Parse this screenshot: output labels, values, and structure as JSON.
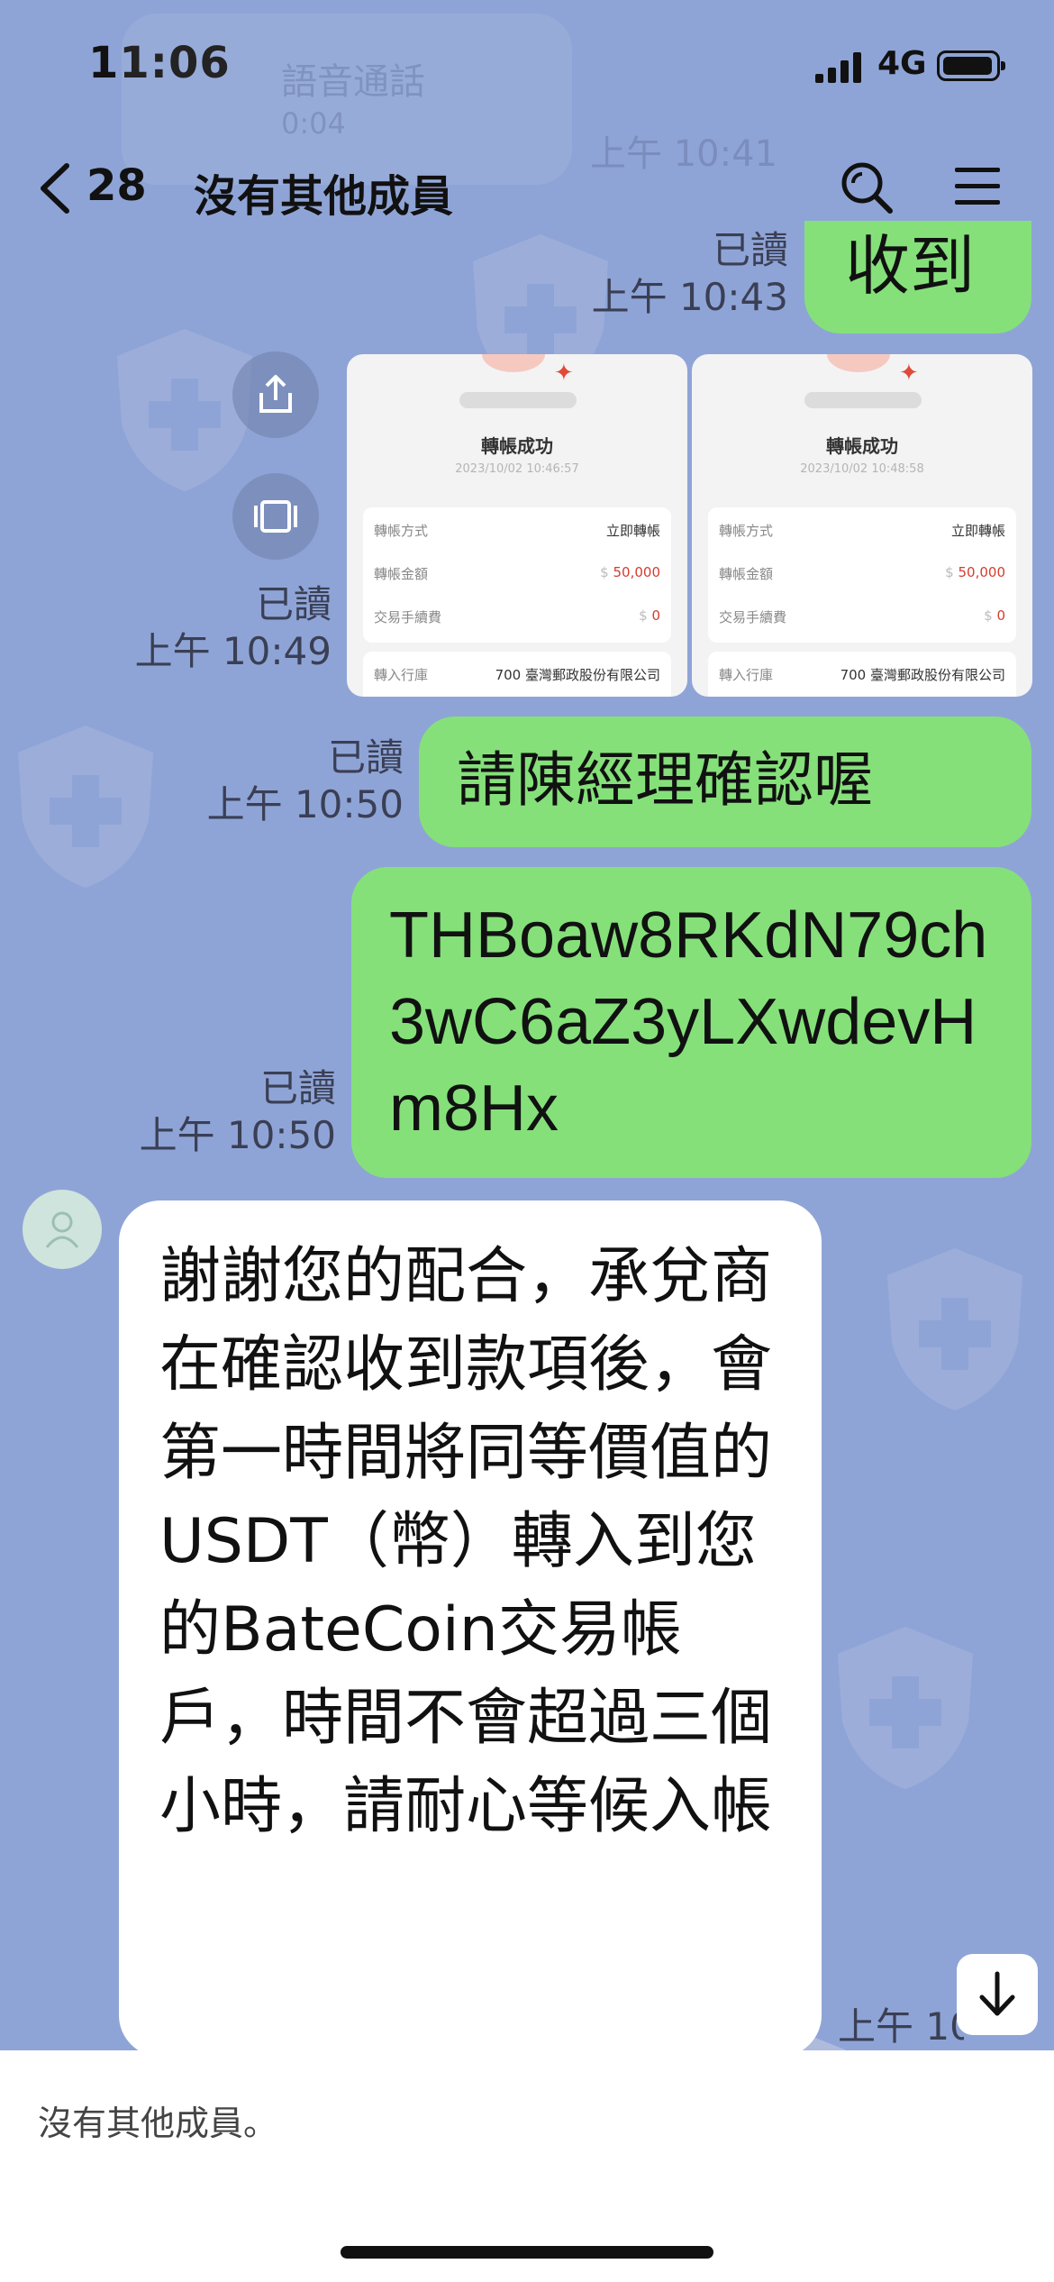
{
  "status_bar": {
    "time": "11:06",
    "network": "4G"
  },
  "ghost": {
    "call_label": "語音通話",
    "call_duration": "0:04",
    "call_time": "上午 10:41"
  },
  "header": {
    "back_count": "28",
    "title": "沒有其他成員"
  },
  "messages": [
    {
      "id": "msg1",
      "text": "收到",
      "read": "已讀",
      "time": "上午 10:43"
    },
    {
      "id": "msg2",
      "type": "images",
      "read": "已讀",
      "time": "上午 10:49",
      "receipts": [
        {
          "title": "轉帳成功",
          "date": "2023/10/02 10:46:57",
          "rows": [
            {
              "label": "轉帳方式",
              "value": "立即轉帳"
            },
            {
              "label": "轉帳金額",
              "currency": "$",
              "value": "50,000"
            },
            {
              "label": "交易手續費",
              "currency": "$",
              "value": "0"
            },
            {
              "label": "轉入行庫",
              "value": "700 臺灣郵政股份有限公司"
            }
          ]
        },
        {
          "title": "轉帳成功",
          "date": "2023/10/02 10:48:58",
          "rows": [
            {
              "label": "轉帳方式",
              "value": "立即轉帳"
            },
            {
              "label": "轉帳金額",
              "currency": "$",
              "value": "50,000"
            },
            {
              "label": "交易手續費",
              "currency": "$",
              "value": "0"
            },
            {
              "label": "轉入行庫",
              "value": "700 臺灣郵政股份有限公司"
            }
          ]
        }
      ]
    },
    {
      "id": "msg3",
      "text": "請陳經理確認喔",
      "read": "已讀",
      "time": "上午 10:50"
    },
    {
      "id": "msg4",
      "text": "THBoaw8RKdN79ch3wC6aZ3yLXwdevHm8Hx",
      "read": "已讀",
      "time": "上午 10:50"
    },
    {
      "id": "msg5",
      "text": "謝謝您的配合，承兌商在確認收到款項後，會第一時間將同等價值的USDT（幣）轉入到您的BateCoin交易帳戶，時間不會超過三個小時，請耐心等候入帳",
      "time": "上午 10:5"
    }
  ],
  "footer": {
    "notice": "沒有其他成員。"
  },
  "colors": {
    "background": "#8fa4d6",
    "outgoing_bubble": "#85e07a",
    "incoming_bubble": "#ffffff"
  }
}
